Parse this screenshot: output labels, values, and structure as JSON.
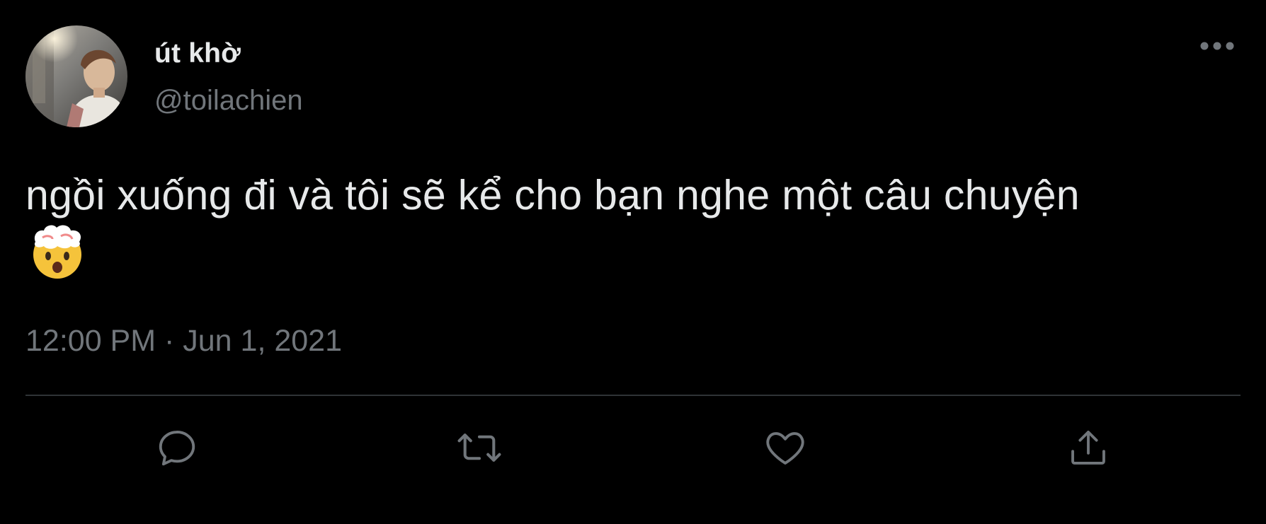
{
  "user": {
    "display_name": "út khờ",
    "handle": "@toilachien"
  },
  "tweet": {
    "text": "ngồi xuống đi và tôi sẽ kể cho bạn nghe một câu chuyện",
    "emoji_icon": "exploding-head-icon",
    "timestamp": "12:00 PM · Jun 1, 2021"
  },
  "actions": [
    {
      "name": "reply",
      "icon": "reply-icon"
    },
    {
      "name": "retweet",
      "icon": "retweet-icon"
    },
    {
      "name": "like",
      "icon": "heart-icon"
    },
    {
      "name": "share",
      "icon": "share-icon"
    }
  ],
  "colors": {
    "background": "#000000",
    "primary_text": "#e7e9ea",
    "secondary_text": "#71767b",
    "divider": "#2f3336"
  }
}
